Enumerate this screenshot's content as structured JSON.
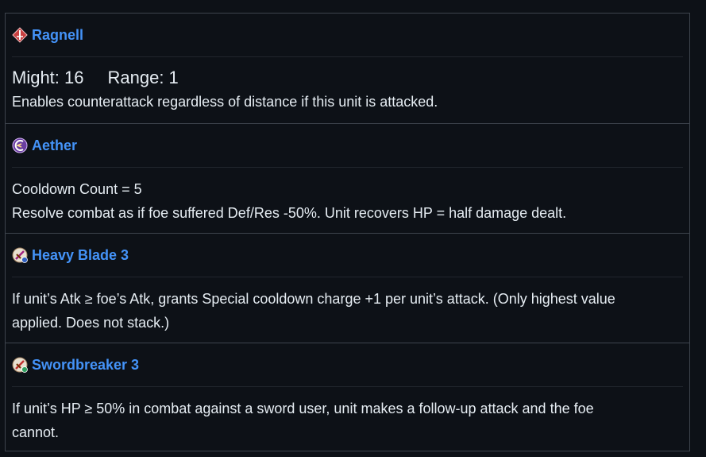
{
  "skills": [
    {
      "name": "Ragnell",
      "icon": "weapon-icon",
      "might_label": "Might: 16",
      "range_label": "Range: 1",
      "description": "Enables counterattack regardless of distance if this unit is attacked."
    },
    {
      "name": "Aether",
      "icon": "special-icon",
      "cooldown": "Cooldown Count = 5",
      "description": "Resolve combat as if foe suffered Def/Res -50%. Unit recovers HP = half damage dealt."
    },
    {
      "name": "Heavy Blade 3",
      "icon": "passive-a-icon",
      "description_line1": "If unit’s Atk ≥ foe’s Atk, grants Special cooldown charge +1 per unit’s attack. (Only highest value",
      "description_line2": "applied. Does not stack.)"
    },
    {
      "name": "Swordbreaker 3",
      "icon": "passive-b-icon",
      "description_line1": "If unit’s HP ≥ 50% in combat against a sword user, unit makes a follow-up attack and the foe",
      "description_line2": "cannot."
    }
  ],
  "colors": {
    "background": "#0d1117",
    "border": "#3d444d",
    "link": "#4493f8",
    "text": "#e6edf3"
  }
}
